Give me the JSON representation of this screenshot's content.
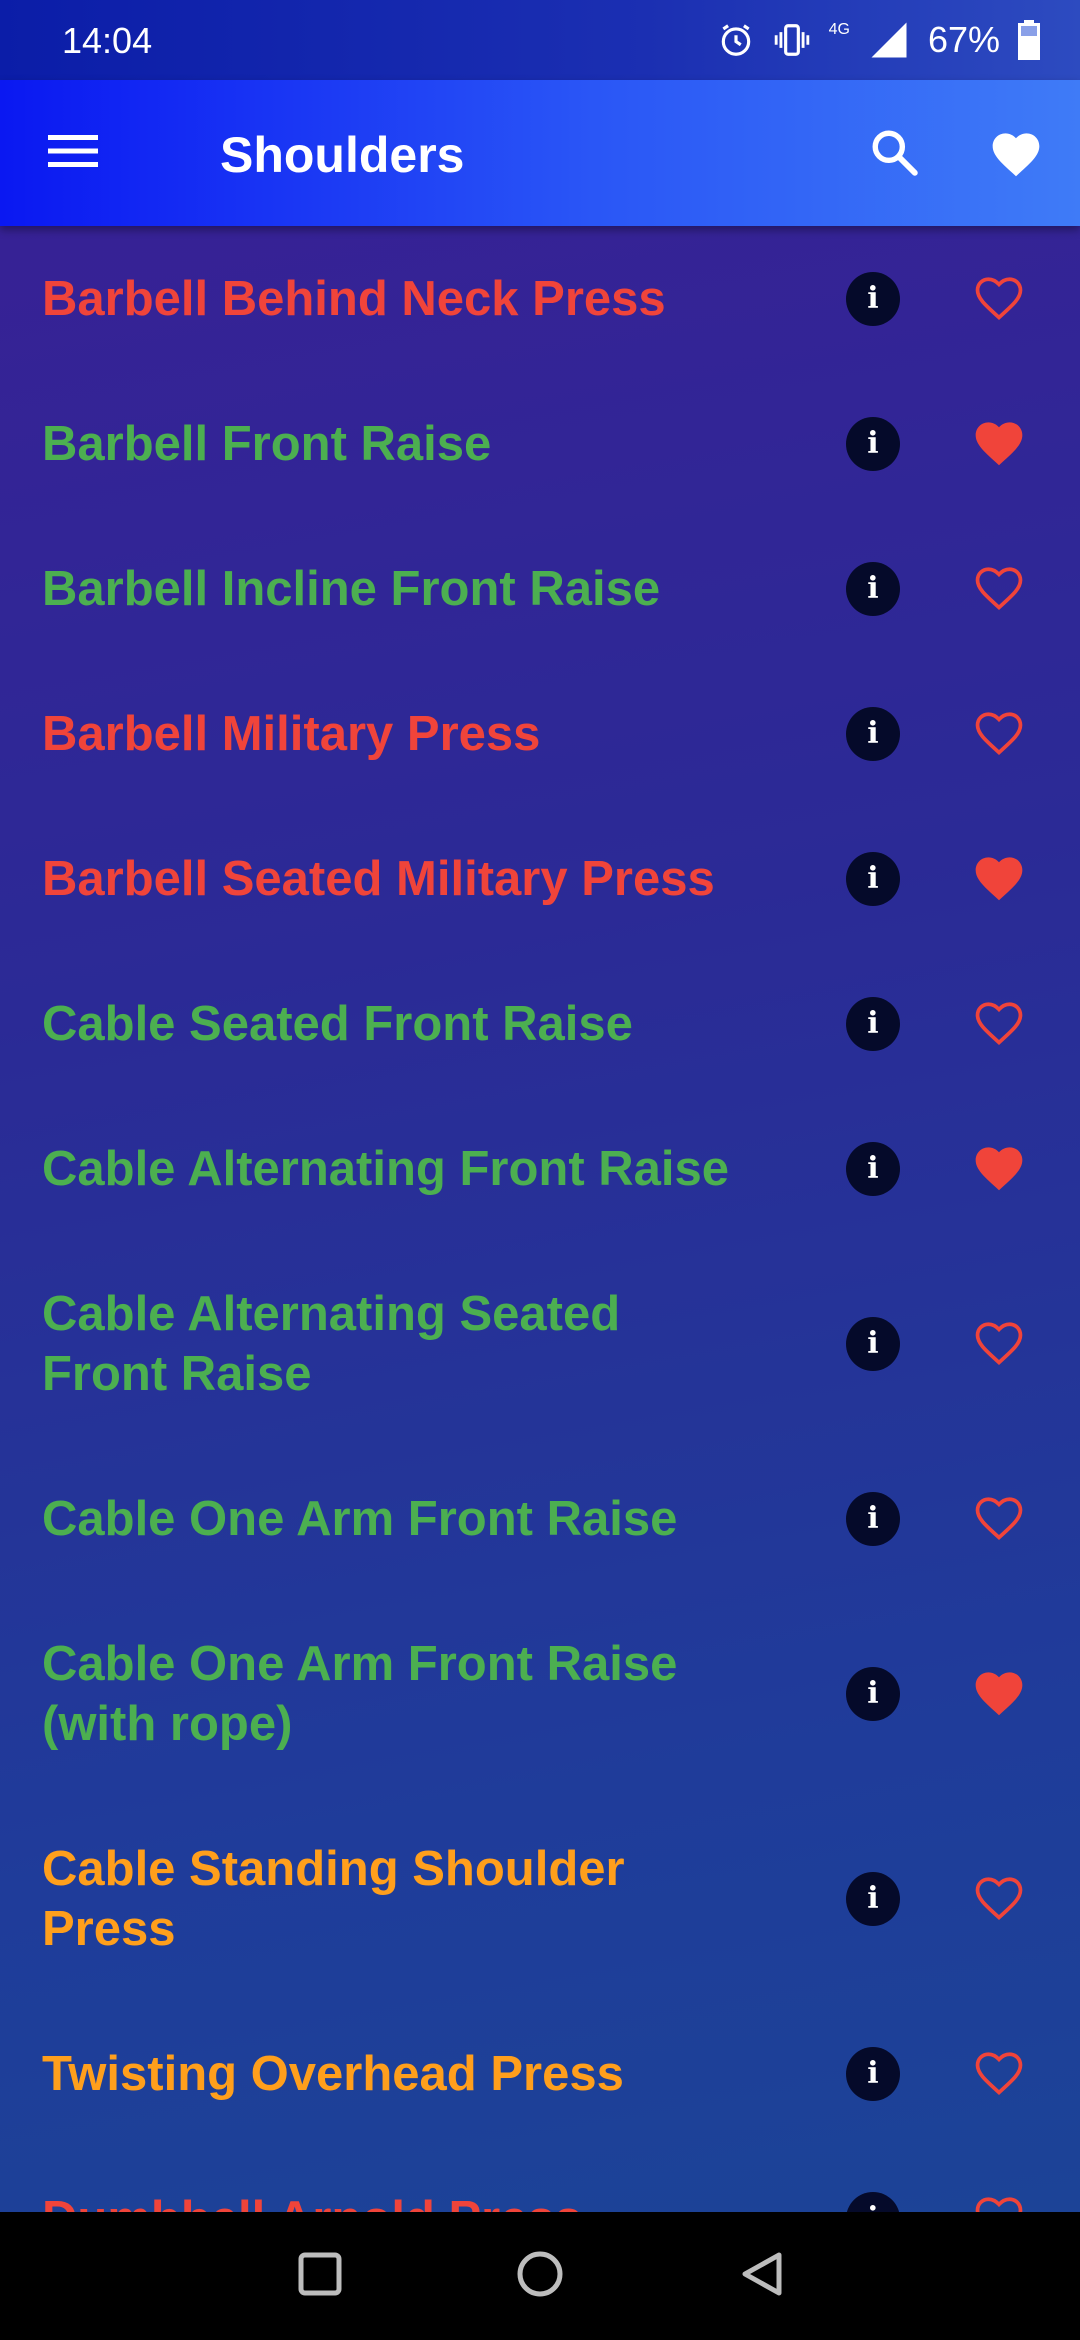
{
  "status_bar": {
    "time": "14:04",
    "network": "4G",
    "battery": "67%"
  },
  "app_bar": {
    "title": "Shoulders",
    "menu_icon": "menu-icon",
    "search_icon": "search-icon",
    "favorites_icon": "heart-icon"
  },
  "colors": {
    "red": "#f0443a",
    "green": "#4caf50",
    "orange": "#ff9f1c",
    "heart": "#f0443a"
  },
  "exercises": [
    {
      "name": "Barbell Behind Neck Press",
      "color": "red",
      "favorite": false
    },
    {
      "name": "Barbell Front Raise",
      "color": "green",
      "favorite": true
    },
    {
      "name": "Barbell Incline Front Raise",
      "color": "green",
      "favorite": false
    },
    {
      "name": "Barbell Military Press",
      "color": "red",
      "favorite": false
    },
    {
      "name": "Barbell Seated Military Press",
      "color": "red",
      "favorite": true
    },
    {
      "name": "Cable Seated Front Raise",
      "color": "green",
      "favorite": false
    },
    {
      "name": "Cable Alternating Front Raise",
      "color": "green",
      "favorite": true
    },
    {
      "name": "Cable Alternating Seated Front Raise",
      "color": "green",
      "favorite": false
    },
    {
      "name": "Cable One Arm Front Raise",
      "color": "green",
      "favorite": false
    },
    {
      "name": "Cable One Arm Front Raise (with rope)",
      "color": "green",
      "favorite": true
    },
    {
      "name": "Cable Standing Shoulder Press",
      "color": "orange",
      "favorite": false
    },
    {
      "name": "Twisting Overhead Press",
      "color": "orange",
      "favorite": false
    },
    {
      "name": "Dumbbell Arnold Press",
      "color": "red",
      "favorite": false
    }
  ],
  "nav_bar": {
    "recents_icon": "square-icon",
    "home_icon": "circle-icon",
    "back_icon": "back-triangle-icon"
  }
}
